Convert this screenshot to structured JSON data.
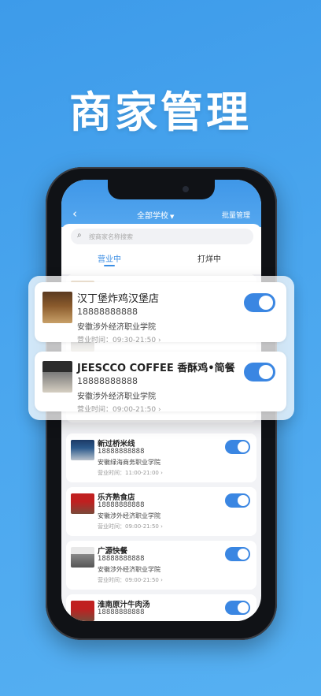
{
  "hero_title": "商家管理",
  "header": {
    "back": "‹",
    "school_select": "全部学校",
    "caret": "▼",
    "batch_manage": "批量管理"
  },
  "search": {
    "icon": "search-icon",
    "placeholder": "按商家名称搜索"
  },
  "tabs": [
    {
      "label": "营业中",
      "active": true
    },
    {
      "label": "打烊中",
      "active": false
    }
  ],
  "featured_cards": [
    {
      "name": "汉丁堡炸鸡汉堡店",
      "phone": "18888888888",
      "school": "安徽涉外经济职业学院",
      "hours": "营业时间：09:30-21:50  ›",
      "enabled": true
    },
    {
      "name": "JEESCCO COFFEE 香酥鸡•简餐",
      "phone": "18888888888",
      "school": "安徽涉外经济职业学院",
      "hours": "营业时间：09:00-21:50  ›",
      "enabled": true
    }
  ],
  "list": [
    {
      "name": "新过桥米线",
      "phone": "18888888888",
      "school": "安徽绿海商务职业学院",
      "hours": "营业时间：11:00-21:00  ›",
      "enabled": true
    },
    {
      "name": "乐齐熟食店",
      "phone": "18888888888",
      "school": "安徽涉外经济职业学院",
      "hours": "营业时间：09:00-21:50  ›",
      "enabled": true
    },
    {
      "name": "广源快餐",
      "phone": "18888888888",
      "school": "安徽涉外经济职业学院",
      "hours": "营业时间：09:00-21:50  ›",
      "enabled": true
    },
    {
      "name": "淮南原汁牛肉汤",
      "phone": "18888888888",
      "school": "",
      "hours": "",
      "enabled": true
    }
  ],
  "colors": {
    "accent": "#3a86e2",
    "background": "#4aa6ee"
  }
}
